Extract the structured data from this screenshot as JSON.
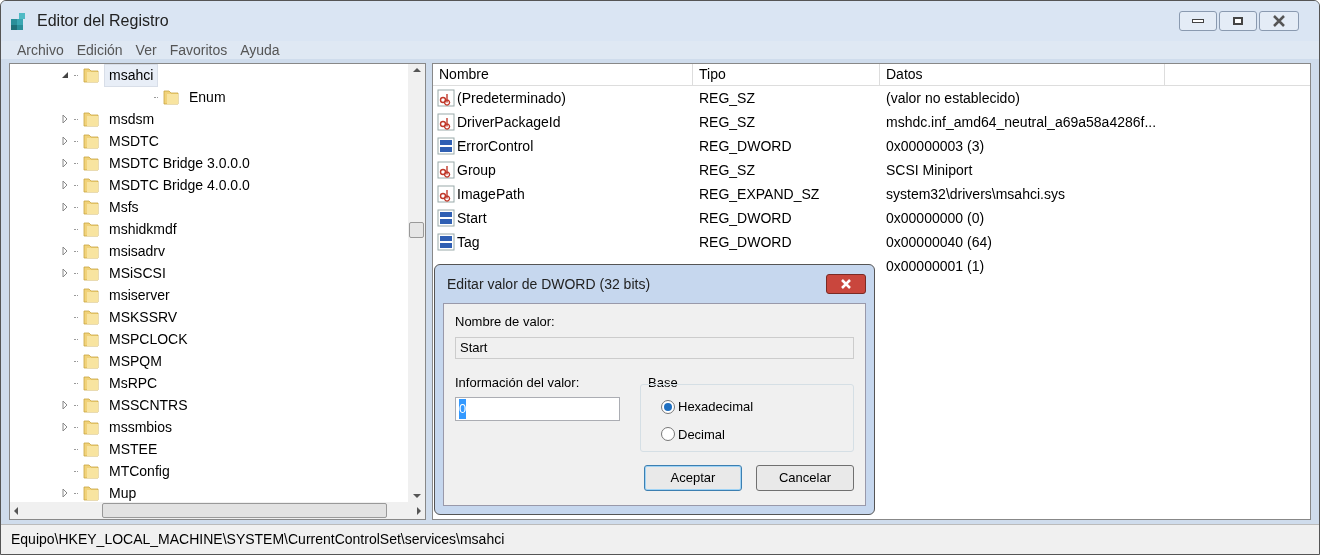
{
  "window": {
    "title": "Editor del Registro"
  },
  "menu": [
    "Archivo",
    "Edición",
    "Ver",
    "Favoritos",
    "Ayuda"
  ],
  "tree": [
    {
      "label": "msahci",
      "selected": true,
      "expanded": true,
      "children": [
        {
          "label": "Enum",
          "selected": false,
          "expandable": false
        }
      ]
    },
    {
      "label": "msdsm",
      "selected": false,
      "expandable": true
    },
    {
      "label": "MSDTC",
      "selected": false,
      "expandable": true
    },
    {
      "label": "MSDTC Bridge 3.0.0.0",
      "selected": false,
      "expandable": true
    },
    {
      "label": "MSDTC Bridge 4.0.0.0",
      "selected": false,
      "expandable": true
    },
    {
      "label": "Msfs",
      "selected": false,
      "expandable": true
    },
    {
      "label": "mshidkmdf",
      "selected": false,
      "expandable": false
    },
    {
      "label": "msisadrv",
      "selected": false,
      "expandable": true
    },
    {
      "label": "MSiSCSI",
      "selected": false,
      "expandable": true
    },
    {
      "label": "msiserver",
      "selected": false,
      "expandable": false
    },
    {
      "label": "MSKSSRV",
      "selected": false,
      "expandable": false
    },
    {
      "label": "MSPCLOCK",
      "selected": false,
      "expandable": false
    },
    {
      "label": "MSPQM",
      "selected": false,
      "expandable": false
    },
    {
      "label": "MsRPC",
      "selected": false,
      "expandable": false
    },
    {
      "label": "MSSCNTRS",
      "selected": false,
      "expandable": true
    },
    {
      "label": "mssmbios",
      "selected": false,
      "expandable": true
    },
    {
      "label": "MSTEE",
      "selected": false,
      "expandable": false
    },
    {
      "label": "MTConfig",
      "selected": false,
      "expandable": false
    },
    {
      "label": "Mup",
      "selected": false,
      "expandable": true
    }
  ],
  "table": {
    "columns": [
      "Nombre",
      "Tipo",
      "Datos"
    ],
    "rows": [
      {
        "kind": "string",
        "name": "(Predeterminado)",
        "type": "REG_SZ",
        "data": "(valor no establecido)"
      },
      {
        "kind": "string",
        "name": "DriverPackageId",
        "type": "REG_SZ",
        "data": "mshdc.inf_amd64_neutral_a69a58a4286f..."
      },
      {
        "kind": "binary",
        "name": "ErrorControl",
        "type": "REG_DWORD",
        "data": "0x00000003 (3)"
      },
      {
        "kind": "string",
        "name": "Group",
        "type": "REG_SZ",
        "data": "SCSI Miniport"
      },
      {
        "kind": "string",
        "name": "ImagePath",
        "type": "REG_EXPAND_SZ",
        "data": "system32\\drivers\\msahci.sys"
      },
      {
        "kind": "binary",
        "name": "Start",
        "type": "REG_DWORD",
        "data": "0x00000000 (0)"
      },
      {
        "kind": "binary",
        "name": "Tag",
        "type": "REG_DWORD",
        "data": "0x00000040 (64)"
      },
      {
        "data": "0x00000001 (1)"
      }
    ]
  },
  "dialog": {
    "title": "Editar valor de DWORD (32 bits)",
    "name_label": "Nombre de valor:",
    "name_value": "Start",
    "value_label": "Información del valor:",
    "value": "0",
    "base_label": "Base",
    "bases": [
      {
        "label": "Hexadecimal",
        "selected": true
      },
      {
        "label": "Decimal",
        "selected": false
      }
    ],
    "buttons": [
      {
        "label": "Aceptar",
        "default": true
      },
      {
        "label": "Cancelar",
        "default": false
      }
    ]
  },
  "status_bar": "Equipo\\HKEY_LOCAL_MACHINE\\SYSTEM\\CurrentControlSet\\services\\msahci"
}
